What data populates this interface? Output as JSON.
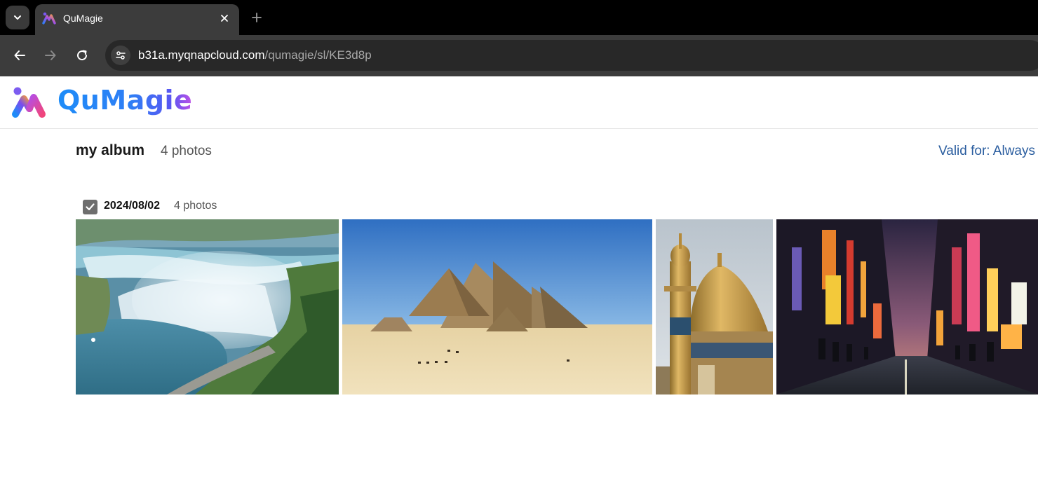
{
  "browser": {
    "tab_title": "QuMagie",
    "url_host": "b31a.myqnapcloud.com",
    "url_path": "/qumagie/sl/KE3d8p"
  },
  "app": {
    "logo_text": "QuMagie"
  },
  "album": {
    "title": "my album",
    "count": "4 photos",
    "valid_for": "Valid for: Always"
  },
  "date_group": {
    "date": "2024/08/02",
    "count": "4 photos",
    "checked": true
  },
  "photos": [
    {
      "subject": "waterfall"
    },
    {
      "subject": "pyramids"
    },
    {
      "subject": "golden-dome-mosque"
    },
    {
      "subject": "city-street-night"
    }
  ],
  "colors": {
    "brand_blue": "#1d8cf8",
    "brand_purple": "#c051e6",
    "link_blue": "#2a5d9f",
    "chrome_dark": "#3c3c3c"
  }
}
